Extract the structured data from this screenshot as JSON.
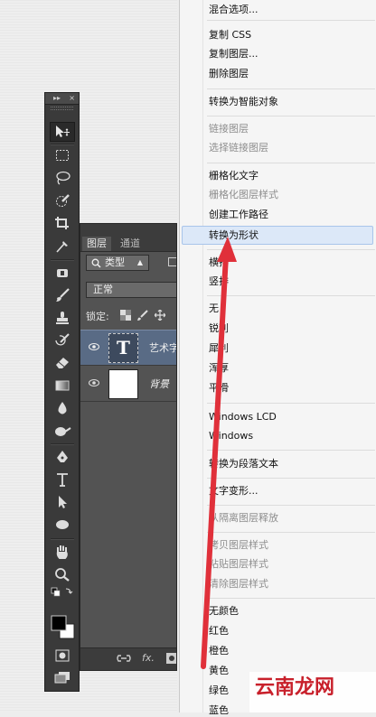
{
  "toolbar": {
    "header_collapse": "▸▸",
    "header_close": "×",
    "tools": [
      "move-tool",
      "marquee-tool",
      "lasso-tool",
      "quick-selection-tool",
      "crop-tool",
      "eyedropper-tool",
      "spot-healing-tool",
      "brush-tool",
      "clone-stamp-tool",
      "history-brush-tool",
      "eraser-tool",
      "gradient-tool",
      "blur-tool",
      "dodge-tool",
      "pen-tool",
      "type-tool",
      "path-selection-tool",
      "shape-tool",
      "hand-tool",
      "zoom-tool",
      "color-swatches",
      "quick-mask-tool",
      "screen-mode-tool"
    ]
  },
  "layers_panel": {
    "tab_layers": "图层",
    "tab_channels": "通道",
    "filter_label": "类型",
    "blend_mode": "正常",
    "lock_label": "锁定:",
    "layers": [
      {
        "name": "艺术字",
        "thumbnail_letter": "T",
        "selected": true
      },
      {
        "name": "背景",
        "selected": false
      }
    ],
    "footer_fx": "fx."
  },
  "context_menu": {
    "items": [
      {
        "label": "混合选项...",
        "enabled": true
      },
      {
        "label": "复制 CSS",
        "enabled": true
      },
      {
        "label": "复制图层...",
        "enabled": true
      },
      {
        "label": "删除图层",
        "enabled": true
      },
      {
        "label": "转换为智能对象",
        "enabled": true
      },
      {
        "label": "链接图层",
        "enabled": false
      },
      {
        "label": "选择链接图层",
        "enabled": false
      },
      {
        "label": "栅格化文字",
        "enabled": true
      },
      {
        "label": "栅格化图层样式",
        "enabled": false
      },
      {
        "label": "创建工作路径",
        "enabled": true
      },
      {
        "label": "转换为形状",
        "enabled": true,
        "highlighted": true
      },
      {
        "label": "横排",
        "enabled": true
      },
      {
        "label": "竖排",
        "enabled": true
      },
      {
        "label": "无",
        "enabled": true
      },
      {
        "label": "锐利",
        "enabled": true
      },
      {
        "label": "犀利",
        "enabled": true
      },
      {
        "label": "浑厚",
        "enabled": true
      },
      {
        "label": "平滑",
        "enabled": true
      },
      {
        "label": "Windows LCD",
        "enabled": true
      },
      {
        "label": "Windows",
        "enabled": true
      },
      {
        "label": "转换为段落文本",
        "enabled": true
      },
      {
        "label": "文字变形...",
        "enabled": true
      },
      {
        "label": "从隔离图层释放",
        "enabled": false
      },
      {
        "label": "拷贝图层样式",
        "enabled": false
      },
      {
        "label": "粘贴图层样式",
        "enabled": false
      },
      {
        "label": "清除图层样式",
        "enabled": false
      },
      {
        "label": "无颜色",
        "enabled": true
      },
      {
        "label": "红色",
        "enabled": true
      },
      {
        "label": "橙色",
        "enabled": true
      },
      {
        "label": "黄色",
        "enabled": true
      },
      {
        "label": "绿色",
        "enabled": true
      },
      {
        "label": "蓝色",
        "enabled": true
      }
    ]
  },
  "watermark": "云南龙网",
  "colors": {
    "highlight": "#dce8f8",
    "arrow": "#e0303a",
    "layer_selected": "#596b85"
  }
}
